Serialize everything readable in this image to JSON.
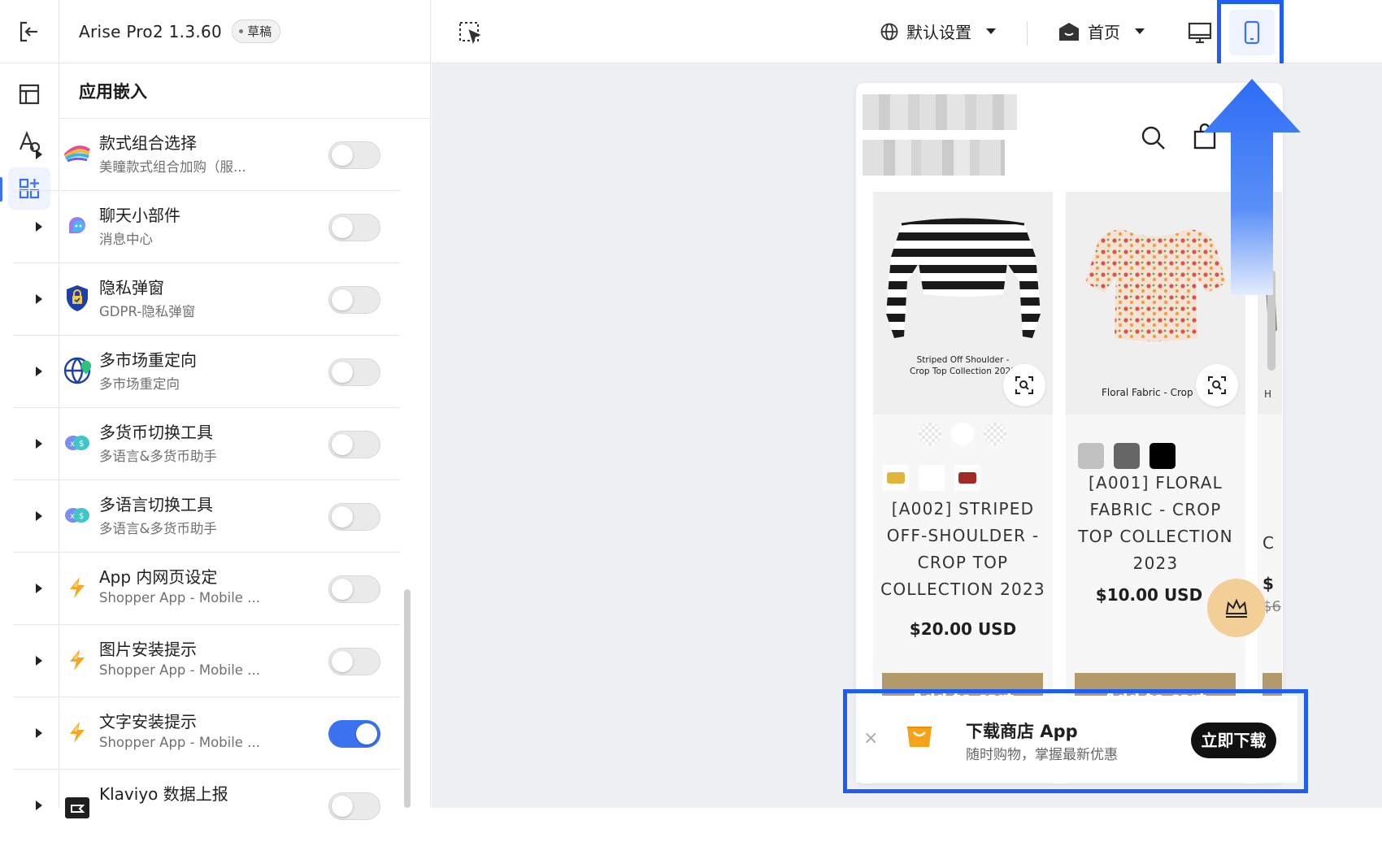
{
  "header": {
    "app_name": "Arise Pro2 1.3.60",
    "status_badge": "草稿"
  },
  "panel": {
    "section_title": "应用嵌入",
    "items": [
      {
        "title": "款式组合选择",
        "subtitle": "美瞳款式组合加购（服...",
        "enabled": false,
        "icon": "rainbow-arc-icon"
      },
      {
        "title": "聊天小部件",
        "subtitle": "消息中心",
        "enabled": false,
        "icon": "chat-bubble-icon"
      },
      {
        "title": "隐私弹窗",
        "subtitle": "GDPR-隐私弹窗",
        "enabled": false,
        "icon": "shield-lock-icon"
      },
      {
        "title": "多市场重定向",
        "subtitle": "多市场重定向",
        "enabled": false,
        "icon": "globe-pin-icon"
      },
      {
        "title": "多货币切换工具",
        "subtitle": "多语言&多货币助手",
        "enabled": false,
        "icon": "currency-bubble-icon"
      },
      {
        "title": "多语言切换工具",
        "subtitle": "多语言&多货币助手",
        "enabled": false,
        "icon": "language-bubble-icon"
      },
      {
        "title": "App 内网页设定",
        "subtitle": "Shopper App - Mobile ...",
        "enabled": false,
        "icon": "lightning-icon"
      },
      {
        "title": "图片安装提示",
        "subtitle": "Shopper App - Mobile ...",
        "enabled": false,
        "icon": "lightning-icon"
      },
      {
        "title": "文字安装提示",
        "subtitle": "Shopper App - Mobile ...",
        "enabled": true,
        "icon": "lightning-icon"
      },
      {
        "title": "Klaviyo 数据上报",
        "subtitle": "",
        "enabled": false,
        "icon": "klaviyo-flag-icon"
      }
    ]
  },
  "toolbar": {
    "locale_label": "默认设置",
    "page_label": "首页",
    "active_device": "mobile"
  },
  "preview": {
    "products": [
      {
        "image_caption": "Striped Off Shoulder - Crop Top Collection 2023",
        "title_lines": [
          "[A002] STRIPED",
          "OFF-SHOULDER -",
          "CROP TOP",
          "COLLECTION 2023"
        ],
        "price": "$20.00 USD",
        "button": "Add to cart"
      },
      {
        "image_caption": "Floral Fabric - Crop To",
        "title_lines": [
          "[A001] FLORAL",
          "FABRIC - CROP",
          "TOP COLLECTION",
          "2023"
        ],
        "price": "$10.00 USD",
        "button": "Add to cart"
      }
    ],
    "third_card_partial": {
      "letter": "C",
      "price": "$",
      "old_price": "$6",
      "caption": "H"
    }
  },
  "banner": {
    "close": "×",
    "title": "下载商店 App",
    "subtitle": "随时购物，掌握最新优惠",
    "button": "立即下载"
  },
  "colors": {
    "accent": "#3a72f0",
    "highlight_border": "#1f5ef0",
    "add_to_cart": "#b49a6a",
    "crown_bg": "#f3cf98"
  }
}
